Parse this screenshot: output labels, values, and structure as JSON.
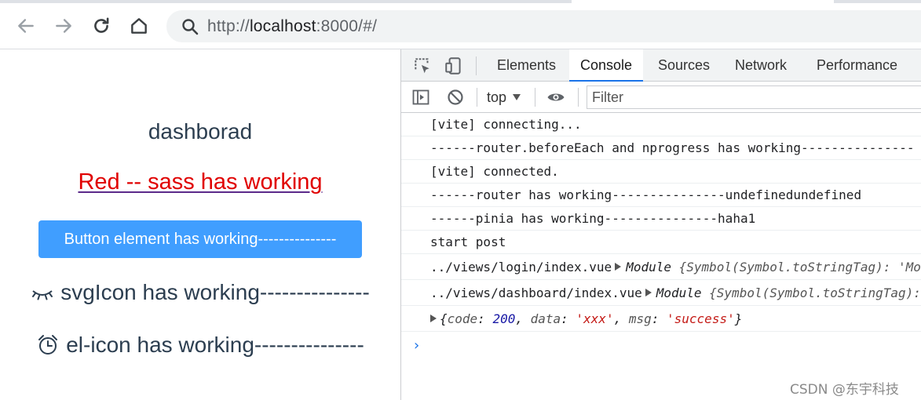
{
  "browser": {
    "url_host": "localhost",
    "url_prefix": "http://",
    "url_suffix": ":8000/#/"
  },
  "page": {
    "title": "dashborad",
    "sass_text": "Red -- sass has working",
    "button_label": "Button element has working---------------",
    "svg_icon_text": "svgIcon has working---------------",
    "el_icon_text": "el-icon has working---------------",
    "colors": {
      "button": "#409eff",
      "sass_red": "#e00000",
      "text": "#2c3e50"
    }
  },
  "devtools": {
    "tabs": [
      "Elements",
      "Console",
      "Sources",
      "Network",
      "Performance"
    ],
    "active_tab": "Console",
    "context": "top",
    "filter_placeholder": "Filter",
    "messages": [
      "[vite] connecting...",
      "------router.beforeEach and nprogress has working---------------",
      "[vite] connected.",
      "------router has working---------------undefinedundefined",
      "------pinia has working---------------haha1",
      "start post"
    ],
    "module_logs": [
      {
        "path": "../views/login/index.vue",
        "label": "Module",
        "detail": "{Symbol(Symbol.toStringTag): 'Module'"
      },
      {
        "path": "../views/dashboard/index.vue",
        "label": "Module",
        "detail": "{Symbol(Symbol.toStringTag): 'Module'"
      }
    ],
    "object_log": {
      "open": "{",
      "k1": "code",
      "v1": "200",
      "k2": "data",
      "v2": "'xxx'",
      "k3": "msg",
      "v3": "'success'",
      "close": "}"
    },
    "prompt": "›"
  },
  "watermark": "CSDN @东宇科技"
}
